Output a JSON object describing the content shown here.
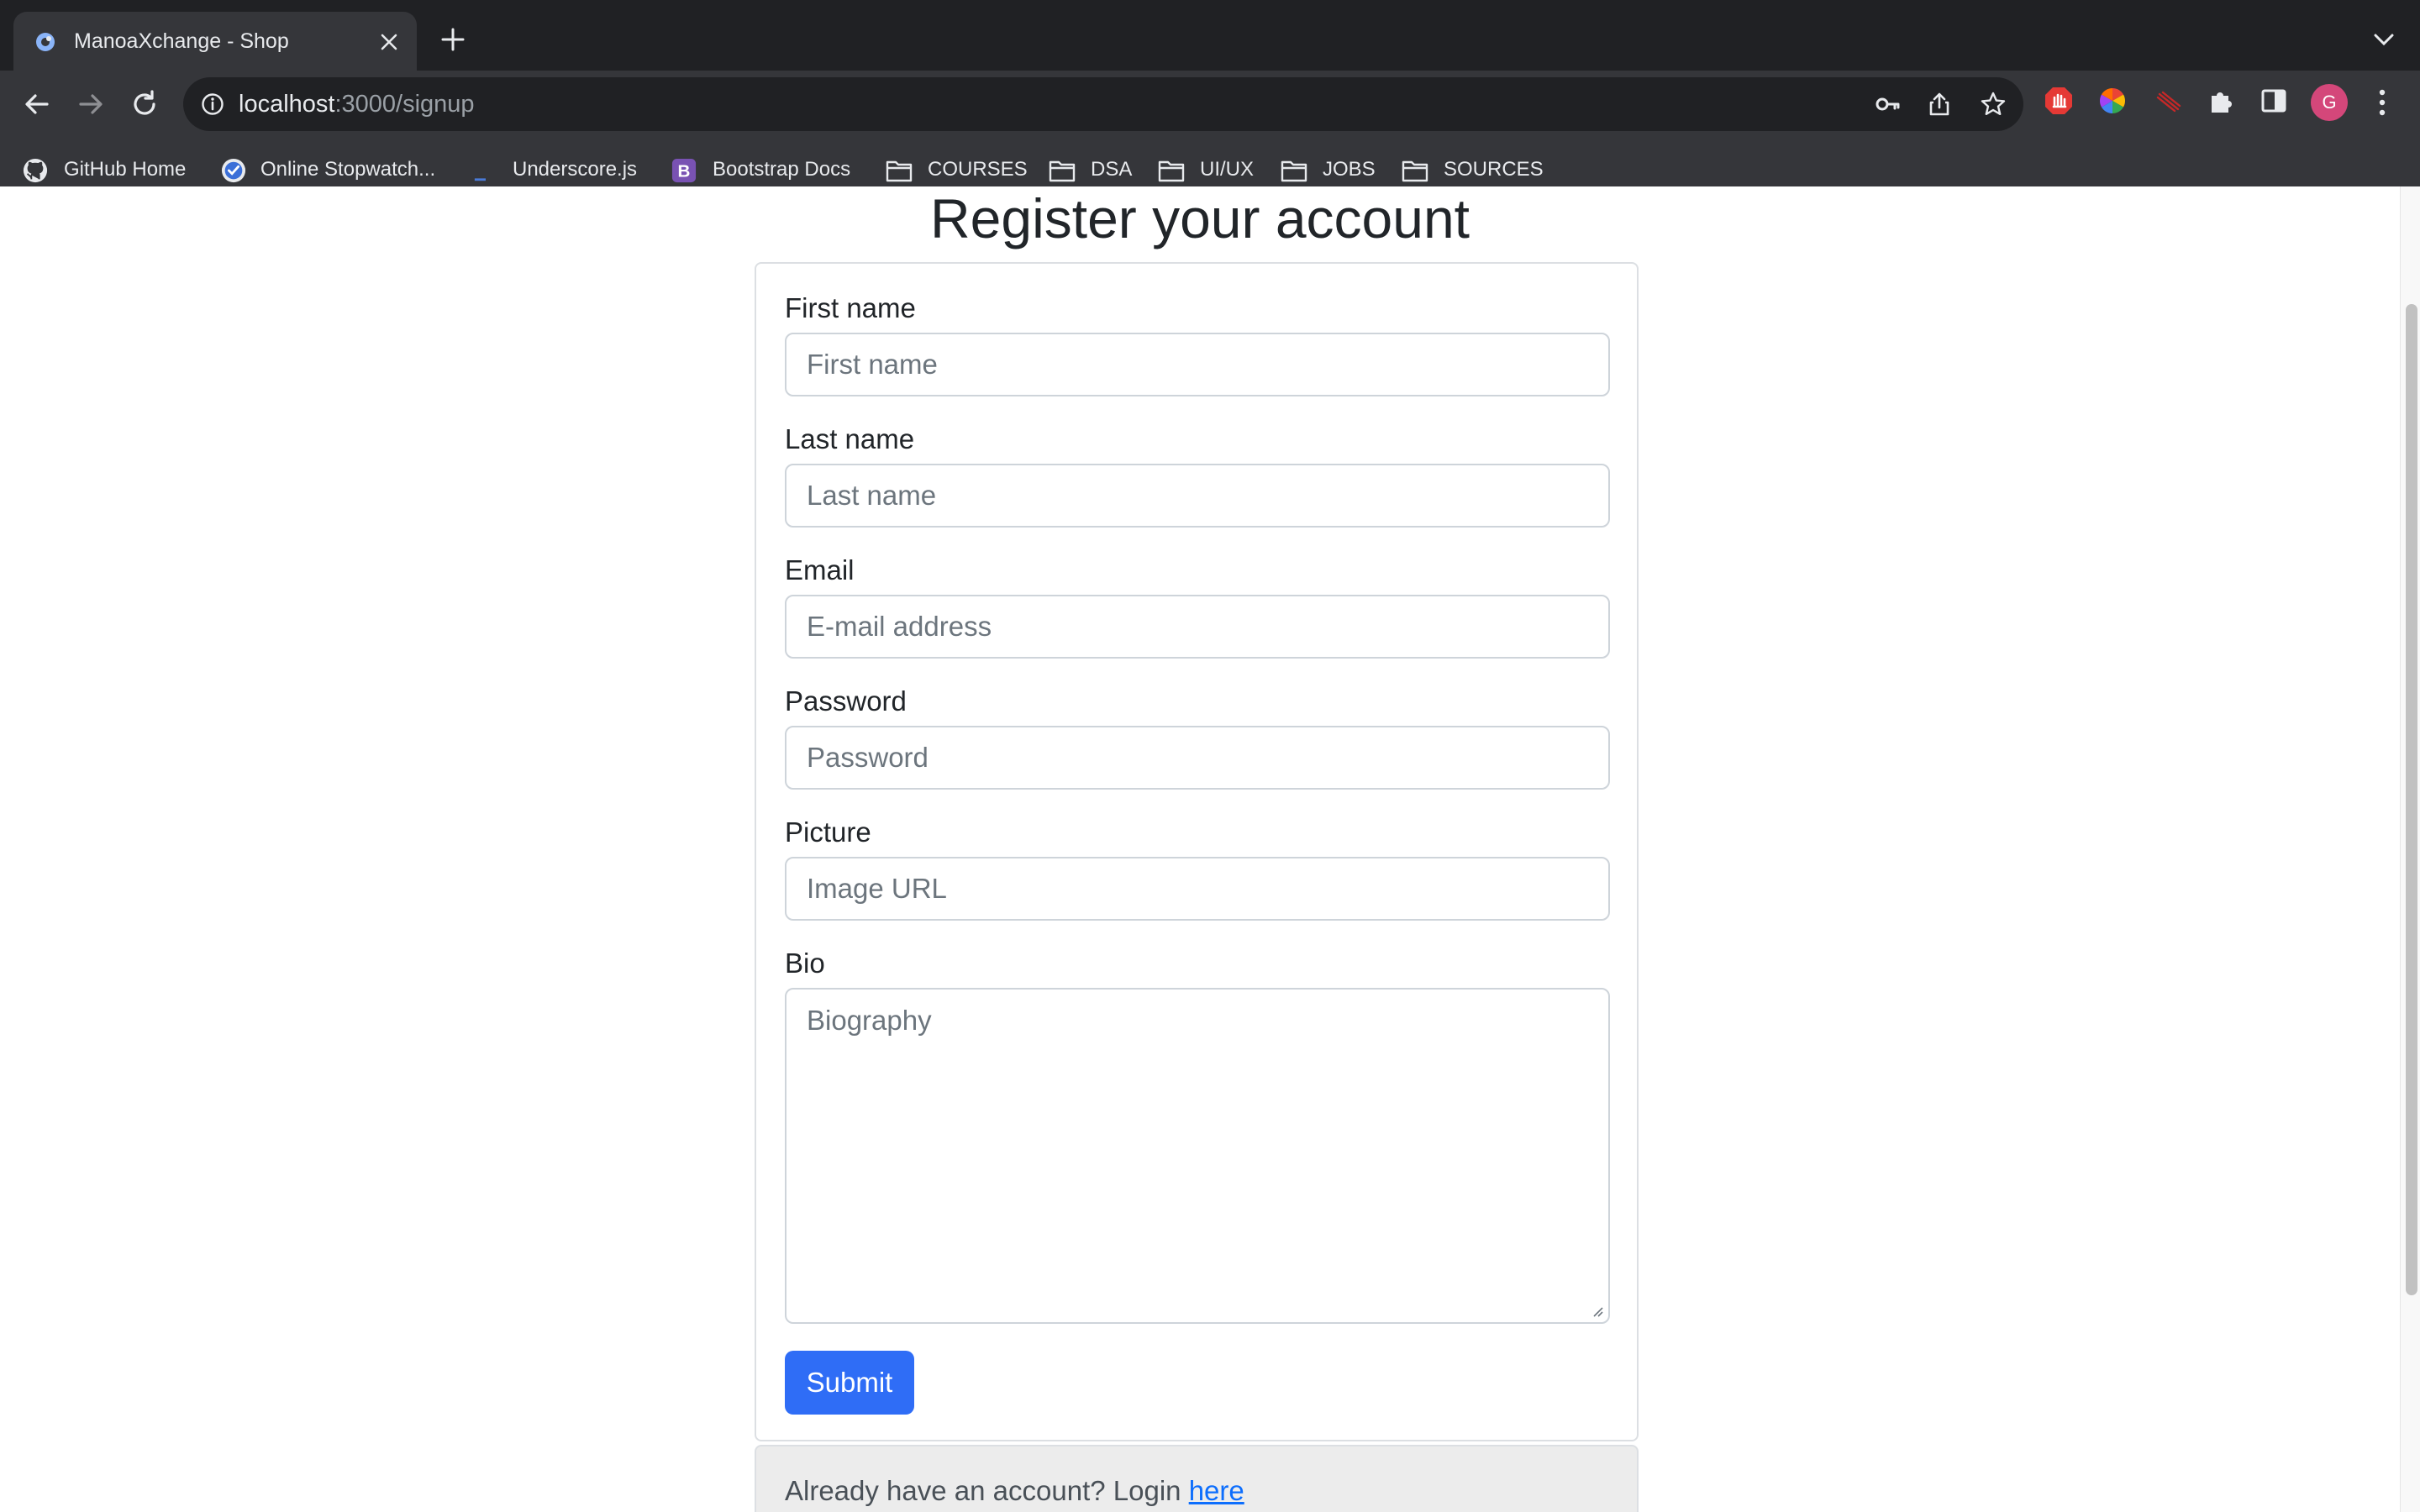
{
  "browser": {
    "tab": {
      "title": "ManoaXchange - Shop"
    },
    "address": {
      "host": "localhost",
      "path": ":3000/signup"
    },
    "profile_initial": "G",
    "bookmarks": [
      {
        "label": "GitHub Home",
        "icon": "github-icon"
      },
      {
        "label": "Online Stopwatch...",
        "icon": "stopwatch-icon"
      },
      {
        "label": "Underscore.js",
        "icon": "underscore-icon"
      },
      {
        "label": "Bootstrap Docs",
        "icon": "bootstrap-icon"
      },
      {
        "label": "COURSES",
        "icon": "folder-icon"
      },
      {
        "label": "DSA",
        "icon": "folder-icon"
      },
      {
        "label": "UI/UX",
        "icon": "folder-icon"
      },
      {
        "label": "JOBS",
        "icon": "folder-icon"
      },
      {
        "label": "SOURCES",
        "icon": "folder-icon"
      }
    ]
  },
  "page": {
    "title": "Register your account",
    "form": {
      "first_name": {
        "label": "First name",
        "placeholder": "First name"
      },
      "last_name": {
        "label": "Last name",
        "placeholder": "Last name"
      },
      "email": {
        "label": "Email",
        "placeholder": "E-mail address"
      },
      "password": {
        "label": "Password",
        "placeholder": "Password"
      },
      "picture": {
        "label": "Picture",
        "placeholder": "Image URL"
      },
      "bio": {
        "label": "Bio",
        "placeholder": "Biography"
      },
      "submit_label": "Submit"
    },
    "footer": {
      "text": "Already have an account? Login ",
      "link_label": "here"
    }
  },
  "colors": {
    "accent": "#2f6df6",
    "link": "#0d6efd",
    "chrome_dark": "#202124",
    "chrome_toolbar": "#35363a"
  }
}
